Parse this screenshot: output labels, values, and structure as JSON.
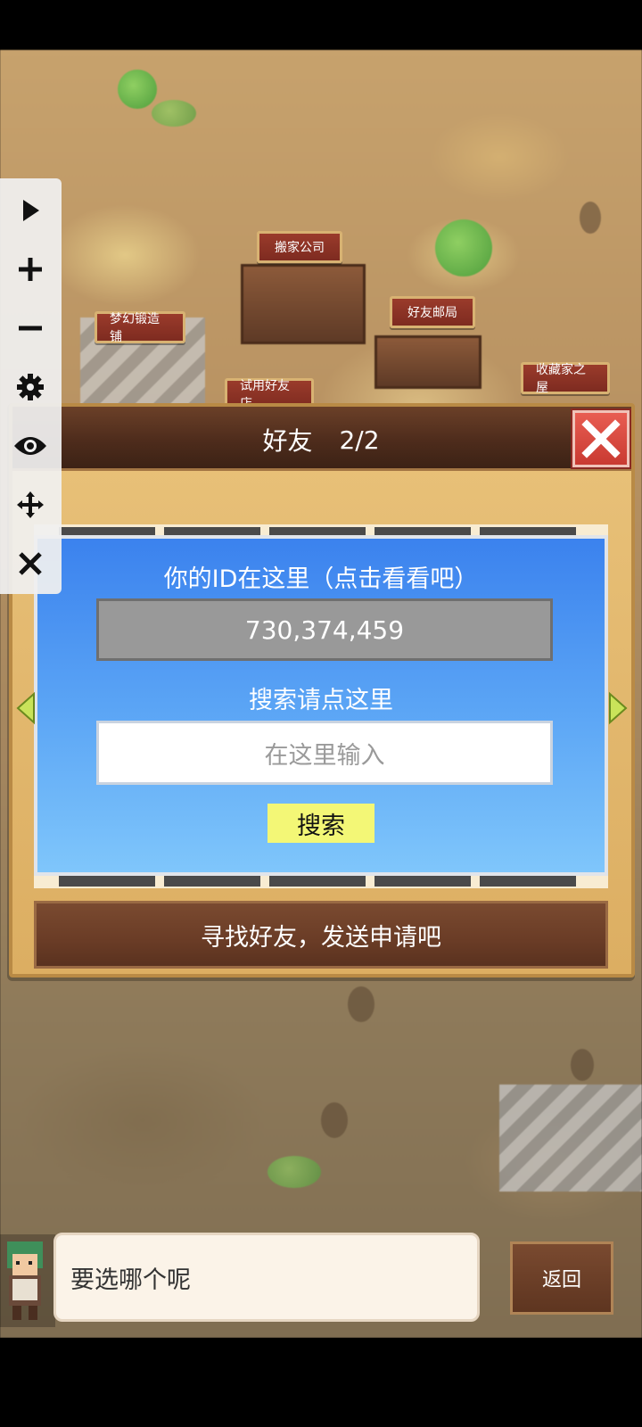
{
  "map_labels": {
    "moving_company": "搬家公司",
    "forge": "梦幻锻造铺",
    "friend_post": "好友邮局",
    "trial_shop": "试用好友店",
    "collector_house": "收藏家之屋"
  },
  "toolbar": {
    "icons": [
      "play-icon",
      "plus-icon",
      "minus-icon",
      "gear-icon",
      "eye-icon",
      "move-icon",
      "close-icon"
    ]
  },
  "dialog": {
    "title": "好友",
    "page": "2/2",
    "id_caption": "你的ID在这里（点击看看吧）",
    "player_id": "730,374,459",
    "search_caption": "搜索请点这里",
    "search_placeholder": "在这里输入",
    "search_button": "搜索",
    "find_friends_button": "寻找好友，发送申请吧"
  },
  "bottom": {
    "speech": "要选哪个呢",
    "back_button": "返回"
  },
  "colors": {
    "panel_blue": "#3b82ee",
    "search_button_yellow": "#f3f776",
    "close_red": "#e85d52",
    "wood_brown": "#6a3c26"
  }
}
